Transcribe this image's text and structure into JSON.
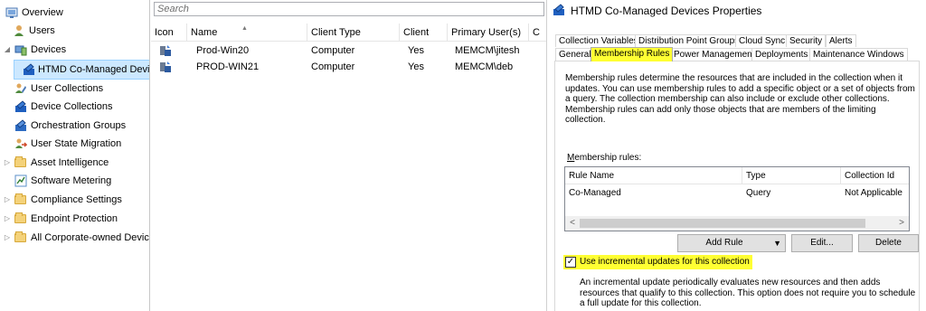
{
  "nav": {
    "items": [
      {
        "label": "Overview",
        "icon": "overview-icon"
      },
      {
        "label": "Users",
        "icon": "users-icon"
      },
      {
        "label": "Devices",
        "icon": "devices-icon",
        "expander": "◢"
      },
      {
        "label": "HTMD Co-Managed Devic",
        "icon": "collection-icon"
      },
      {
        "label": "User Collections",
        "icon": "user-collections-icon"
      },
      {
        "label": "Device Collections",
        "icon": "device-collections-icon"
      },
      {
        "label": "Orchestration Groups",
        "icon": "orchestration-icon"
      },
      {
        "label": "User State Migration",
        "icon": "user-migration-icon"
      },
      {
        "label": "Asset Intelligence",
        "icon": "folder-icon",
        "expander": "▷"
      },
      {
        "label": "Software Metering",
        "icon": "metering-icon"
      },
      {
        "label": "Compliance Settings",
        "icon": "folder-icon",
        "expander": "▷"
      },
      {
        "label": "Endpoint Protection",
        "icon": "folder-icon",
        "expander": "▷"
      },
      {
        "label": "All Corporate-owned Device",
        "icon": "folder-icon",
        "expander": "▷"
      }
    ]
  },
  "list": {
    "search_placeholder": "Search",
    "columns": [
      "Icon",
      "Name",
      "Client Type",
      "Client",
      "Primary User(s)",
      "C"
    ],
    "rows": [
      {
        "name": "Prod-Win20",
        "client_type": "Computer",
        "client": "Yes",
        "primary_user": "MEMCM\\jitesh"
      },
      {
        "name": "PROD-WIN21",
        "client_type": "Computer",
        "client": "Yes",
        "primary_user": "MEMCM\\deb"
      }
    ]
  },
  "dialog": {
    "title": "HTMD Co-Managed Devices Properties",
    "tabs_row1": [
      "Collection Variables",
      "Distribution Point Groups",
      "Cloud Sync",
      "Security",
      "Alerts"
    ],
    "tabs_row2": [
      "General",
      "Membership Rules",
      "Power Management",
      "Deployments",
      "Maintenance Windows"
    ],
    "active_tab": "Membership Rules",
    "description": "Membership rules determine the resources that are included in the collection when it updates. You can use membership rules to add a specific object or a set of objects from a query. The collection membership can also include or exclude other collections. Membership rules can add only those objects that are members of the limiting collection.",
    "rules_label": "Membership rules:",
    "rules_columns": [
      "Rule Name",
      "Type",
      "Collection Id"
    ],
    "rules_rows": [
      {
        "rule_name": "Co-Managed",
        "type": "Query",
        "collection_id": "Not Applicable"
      }
    ],
    "add_rule_label": "Add Rule",
    "edit_label": "Edit...",
    "delete_label": "Delete",
    "incremental_label": "Use incremental updates for this collection",
    "incremental_checked": true,
    "incremental_description": "An incremental update periodically evaluates new resources and then adds resources that qualify to this collection. This option does not require you to schedule a full update for this collection."
  },
  "colors": {
    "highlight": "#ffff33",
    "selection": "#cce8ff",
    "accent_blue": "#1f5fbf"
  }
}
